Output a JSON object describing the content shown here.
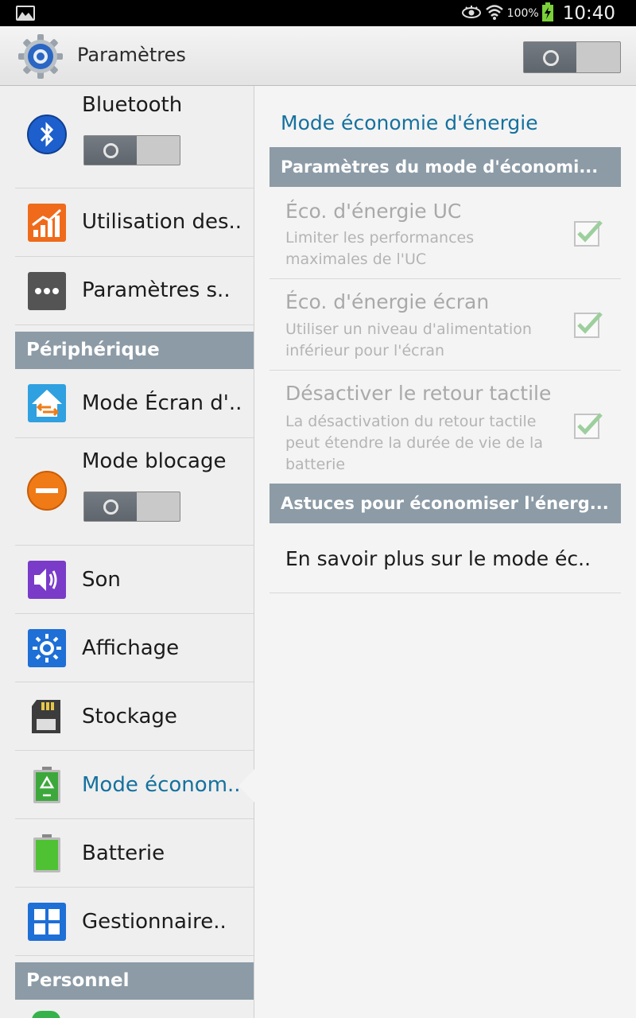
{
  "status_bar": {
    "battery_percent": "100%",
    "time": "10:40",
    "icons": [
      "gallery-icon",
      "eye-icon",
      "wifi-icon",
      "battery-charging-icon"
    ]
  },
  "action_bar": {
    "title": "Paramètres",
    "master_switch": "off"
  },
  "sidebar": {
    "items": [
      {
        "label": "Bluetooth",
        "icon": "bluetooth-icon",
        "switch": "off"
      },
      {
        "label": "Utilisation des..",
        "icon": "data-usage-icon"
      },
      {
        "label": "Paramètres s..",
        "icon": "more-settings-icon"
      },
      {
        "label": "Mode Écran d'..",
        "icon": "home-screen-mode-icon"
      },
      {
        "label": "Mode blocage",
        "icon": "blocking-mode-icon",
        "switch": "off"
      },
      {
        "label": "Son",
        "icon": "sound-icon"
      },
      {
        "label": "Affichage",
        "icon": "display-icon"
      },
      {
        "label": "Stockage",
        "icon": "storage-icon"
      },
      {
        "label": "Mode économ..",
        "icon": "power-saving-icon",
        "selected": true
      },
      {
        "label": "Batterie",
        "icon": "battery-icon"
      },
      {
        "label": "Gestionnaire..",
        "icon": "app-manager-icon"
      }
    ],
    "section_device": "Périphérique",
    "section_personal": "Personnel"
  },
  "detail": {
    "title": "Mode économie d'énergie",
    "section_settings": "Paramètres du mode d'économi...",
    "options": [
      {
        "title": "Éco. d'énergie UC",
        "summary": "Limiter les performances maximales de l'UC",
        "checked": true
      },
      {
        "title": "Éco. d'énergie écran",
        "summary": "Utiliser un niveau d'alimentation inférieur pour l'écran",
        "checked": true
      },
      {
        "title": "Désactiver le retour tactile",
        "summary": "La désactivation du retour tactile peut étendre la durée de vie de la batterie",
        "checked": true
      }
    ],
    "section_tips": "Astuces pour économiser l'énerg...",
    "learn_more": "En savoir plus sur le mode éc.."
  },
  "colors": {
    "accent": "#15719e",
    "section_header_bg": "#8c9ba6",
    "disabled_text": "#a9a9a9"
  }
}
